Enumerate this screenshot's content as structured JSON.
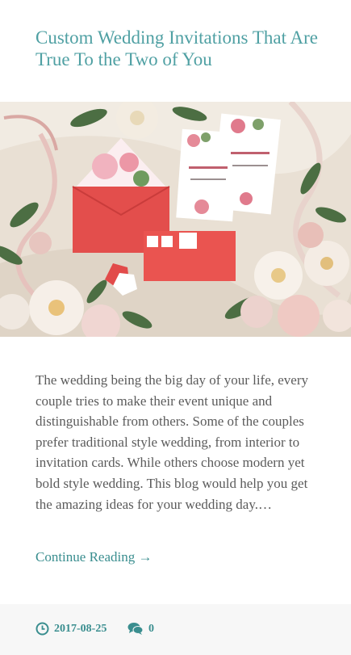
{
  "post": {
    "title": "Custom Wedding Invitations That Are True To the Two of You",
    "image_alt": "Pink floral wedding invitation suite with red envelopes, ribbons and roses",
    "excerpt": "The wedding being the big day of your life, every couple tries to make their event unique and distinguishable from others. Some of the couples prefer traditional style wedding, from interior to invitation cards. While others choose modern yet bold style wedding. This blog would help you get the amazing ideas for your wedding day.…",
    "continue_label": "Continue Reading →",
    "date": "2017-08-25",
    "comments": "0",
    "icons": {
      "date": "clock-icon",
      "comments": "comments-icon"
    }
  },
  "colors": {
    "accent": "#4fa0a3",
    "link": "#3a8e8f",
    "text": "#5b5b5b"
  }
}
